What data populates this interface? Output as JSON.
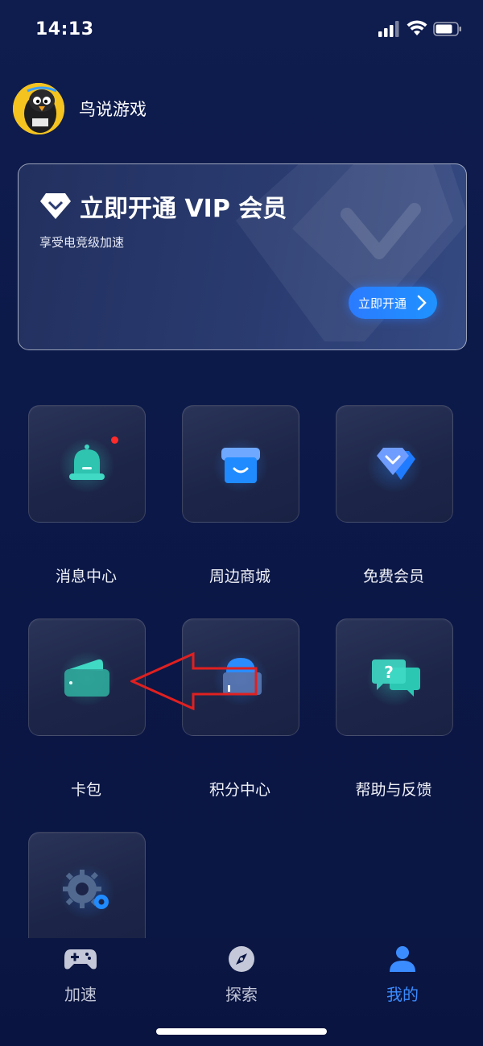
{
  "status_bar": {
    "time": "14:13"
  },
  "profile": {
    "name": "鸟说游戏",
    "avatar_icon": "penguin-avatar"
  },
  "vip": {
    "title": "立即开通 VIP 会员",
    "subtitle": "享受电竞级加速",
    "button_label": "立即开通"
  },
  "grid": {
    "items": [
      {
        "label": "消息中心",
        "icon": "bell-icon",
        "badge": true
      },
      {
        "label": "周边商城",
        "icon": "store-icon"
      },
      {
        "label": "免费会员",
        "icon": "diamond-icon"
      },
      {
        "label": "卡包",
        "icon": "wallet-icon"
      },
      {
        "label": "积分中心",
        "icon": "envelope-icon"
      },
      {
        "label": "帮助与反馈",
        "icon": "help-chat-icon"
      },
      {
        "label": "",
        "icon": "settings-gear-icon"
      }
    ]
  },
  "tabs": [
    {
      "label": "加速",
      "icon": "gamepad-icon",
      "active": false
    },
    {
      "label": "探索",
      "icon": "compass-icon",
      "active": false
    },
    {
      "label": "我的",
      "icon": "user-icon",
      "active": true
    }
  ],
  "colors": {
    "accent": "#3b8cff",
    "annotation_arrow": "#e02020",
    "badge": "#ff2b2b"
  }
}
